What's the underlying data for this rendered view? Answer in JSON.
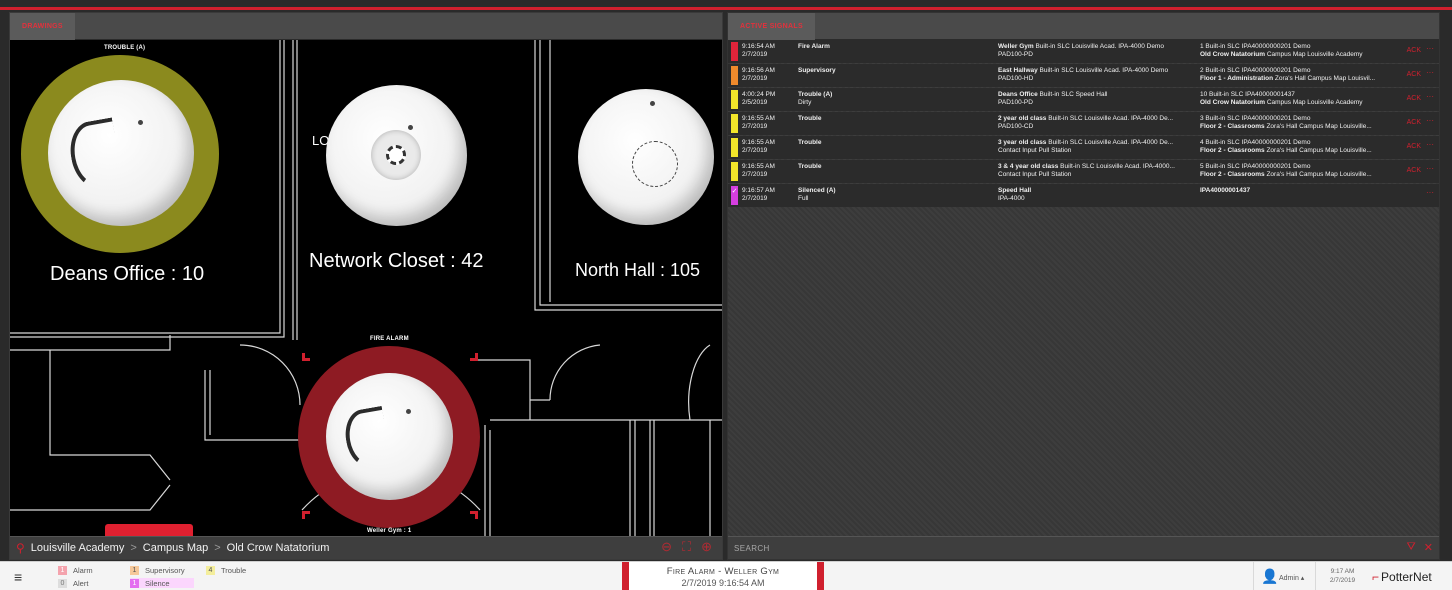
{
  "drawings": {
    "tab_label": "DRAWINGS",
    "labels": {
      "trouble_caption": "TROUBLE (A)",
      "deans": "Deans Office : 10",
      "network": "Network Closet : 42",
      "north": "North Hall : 105",
      "partial": "LO",
      "fire_caption": "FIRE ALARM",
      "weller": "Weller Gym : 1"
    },
    "breadcrumb": [
      "Louisville Academy",
      "Campus Map",
      "Old Crow Natatorium"
    ],
    "separator": ">"
  },
  "signals": {
    "tab_label": "ACTIVE SIGNALS",
    "rows": [
      {
        "color": "#e0243a",
        "time": "9:16:54 AM",
        "date": "2/7/2019",
        "type": "Fire Alarm",
        "type_sub": "",
        "dev_b": "Weller Gym",
        "dev_rest": "  Built-in SLC Louisville Acad. IPA-4000 Demo",
        "dev_sub": "PAD100-PD",
        "loc_line1": "1  Built-in SLC IPA40000000201 Demo",
        "loc_b": "Old Crow Natatorium",
        "loc_rest": "  Campus Map Louisville Academy",
        "ack": "ACK",
        "more": "···"
      },
      {
        "color": "#ef8a2c",
        "time": "9:16:56 AM",
        "date": "2/7/2019",
        "type": "Supervisory",
        "type_sub": "",
        "dev_b": "East Hallway",
        "dev_rest": "  Built-in SLC Louisville Acad. IPA-4000 Demo",
        "dev_sub": "PAD100-HD",
        "loc_line1": "2  Built-in SLC IPA40000000201 Demo",
        "loc_b": "Floor 1 - Administration",
        "loc_rest": "  Zora's Hall Campus Map Louisvil...",
        "ack": "ACK",
        "more": "···"
      },
      {
        "color": "#f2e52a",
        "time": "4:00:24 PM",
        "date": "2/5/2019",
        "type": "Trouble (A)",
        "type_sub": "Dirty",
        "dev_b": "Deans Office",
        "dev_rest": "  Built-in SLC Speed Hall",
        "dev_sub": "PAD100-PD",
        "loc_line1": "10  Built-in SLC IPA40000001437",
        "loc_b": "Old Crow Natatorium",
        "loc_rest": "  Campus Map Louisville Academy",
        "ack": "ACK",
        "more": "···"
      },
      {
        "color": "#f2e52a",
        "time": "9:16:55 AM",
        "date": "2/7/2019",
        "type": "Trouble",
        "type_sub": "",
        "dev_b": "2 year old class",
        "dev_rest": "  Built-in SLC Louisville Acad. IPA-4000 De...",
        "dev_sub": "PAD100-CD",
        "loc_line1": "3  Built-in SLC IPA40000000201 Demo",
        "loc_b": "Floor 2 - Classrooms",
        "loc_rest": "  Zora's Hall Campus Map Louisville...",
        "ack": "ACK",
        "more": "···"
      },
      {
        "color": "#f2e52a",
        "time": "9:16:55 AM",
        "date": "2/7/2019",
        "type": "Trouble",
        "type_sub": "",
        "dev_b": "3 year old class",
        "dev_rest": "  Built-in SLC Louisville Acad. IPA-4000 De...",
        "dev_sub": "Contact Input Pull Station",
        "loc_line1": "4  Built-in SLC IPA40000000201 Demo",
        "loc_b": "Floor 2 - Classrooms",
        "loc_rest": "  Zora's Hall Campus Map Louisville...",
        "ack": "ACK",
        "more": "···"
      },
      {
        "color": "#f2e52a",
        "time": "9:16:55 AM",
        "date": "2/7/2019",
        "type": "Trouble",
        "type_sub": "",
        "dev_b": "3 & 4 year old class",
        "dev_rest": "  Built-in SLC Louisville Acad. IPA-4000...",
        "dev_sub": "Contact Input Pull Station",
        "loc_line1": "5  Built-in SLC IPA40000000201 Demo",
        "loc_b": "Floor 2 - Classrooms",
        "loc_rest": "  Zora's Hall Campus Map Louisville...",
        "ack": "ACK",
        "more": "···"
      },
      {
        "color": "#d63ee0",
        "time": "9:16:57 AM",
        "date": "2/7/2019",
        "type": "Silenced (A)",
        "type_sub": "Full",
        "dev_b": "Speed Hall",
        "dev_rest": "",
        "dev_sub": "IPA-4000",
        "loc_line1": "",
        "loc_b": "IPA40000001437",
        "loc_rest": "",
        "ack": "",
        "more": "···"
      }
    ],
    "search_placeholder": "SEARCH"
  },
  "statusbar": {
    "legend": [
      {
        "count": "1",
        "label": "Alarm",
        "bg": "#f4a3ad",
        "fg": "#fff"
      },
      {
        "count": "0",
        "label": "Alert",
        "bg": "#dddddd",
        "fg": "#777"
      },
      {
        "count": "1",
        "label": "Supervisory",
        "bg": "#f6c89a",
        "fg": "#555"
      },
      {
        "count": "1",
        "label": "Silence",
        "bg": "#e46ef0",
        "fg": "#fff"
      },
      {
        "count": "4",
        "label": "Trouble",
        "bg": "#f4ee9c",
        "fg": "#555"
      }
    ],
    "alarm_title": "Fire Alarm - Weller Gym",
    "alarm_time": "2/7/2019 9:16:54 AM",
    "user": "Admin ▴",
    "clock_time": "9:17 AM",
    "clock_date": "2/7/2019",
    "brand": "PotterNet"
  },
  "colors": {
    "accent": "#d0202e",
    "trouble_ring": "#8b8a1e",
    "alarm_ring": "#8e1b23"
  }
}
